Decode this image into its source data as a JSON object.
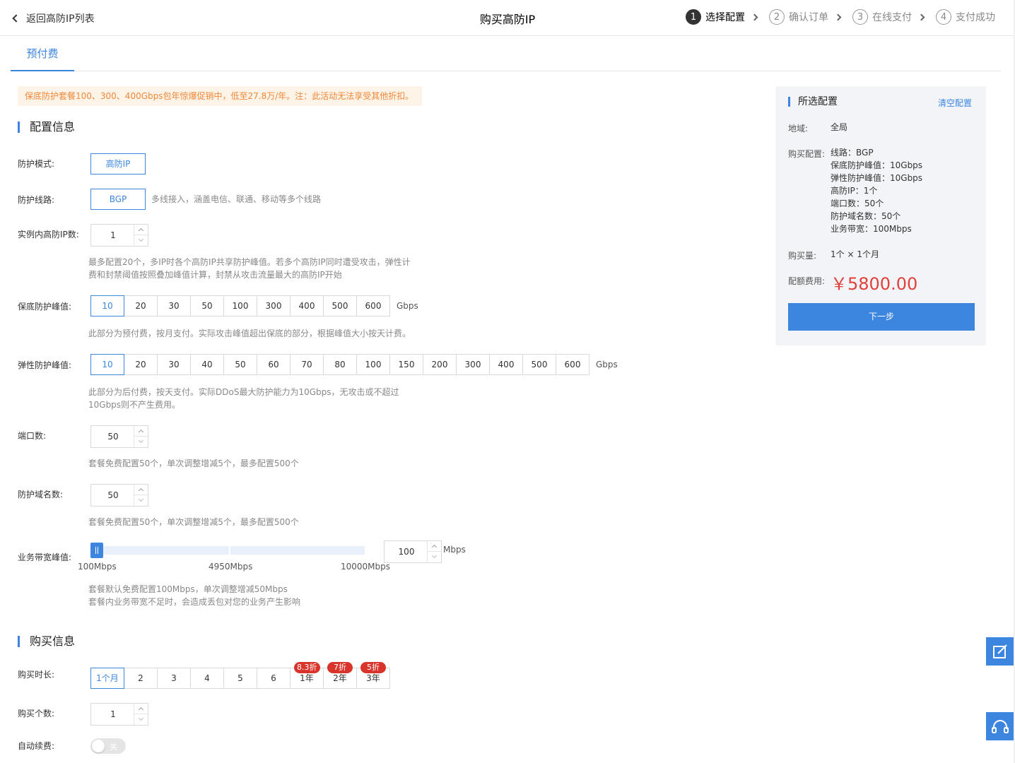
{
  "header": {
    "back_label": "返回高防IP列表",
    "title": "购买高防IP",
    "steps": [
      {
        "num": "1",
        "label": "选择配置"
      },
      {
        "num": "2",
        "label": "确认订单"
      },
      {
        "num": "3",
        "label": "在线支付"
      },
      {
        "num": "4",
        "label": "支付成功"
      }
    ]
  },
  "tab": {
    "label": "预付费"
  },
  "promo": "保底防护套餐100、300、400Gbps包年惊爆促销中，低至27.8万/年。注：此活动无法享受其他折扣。",
  "config": {
    "section_title": "配置信息",
    "mode": {
      "label": "防护模式:",
      "value": "高防IP"
    },
    "line": {
      "label": "防护线路:",
      "value": "BGP",
      "hint": "多线接入，涵盖电信、联通、移动等多个线路"
    },
    "ip_count": {
      "label": "实例内高防IP数:",
      "value": "1",
      "hint1": "最多配置20个，多IP时各个高防IP共享防护峰值。若多个高防IP同时遭受攻击，弹性计",
      "hint2": "费和封禁阈值按照叠加峰值计算，封禁从攻击流量最大的高防IP开始"
    },
    "base_peak": {
      "label": "保底防护峰值:",
      "options": [
        "10",
        "20",
        "30",
        "50",
        "100",
        "300",
        "400",
        "500",
        "600"
      ],
      "selected": "10",
      "unit": "Gbps",
      "hint": "此部分为预付费，按月支付。实际攻击峰值超出保底的部分，根据峰值大小按天计费。"
    },
    "elastic_peak": {
      "label": "弹性防护峰值:",
      "options": [
        "10",
        "20",
        "30",
        "40",
        "50",
        "60",
        "70",
        "80",
        "100",
        "150",
        "200",
        "300",
        "400",
        "500",
        "600"
      ],
      "selected": "10",
      "unit": "Gbps",
      "hint1": "此部分为后付费，按天支付。实际DDoS最大防护能力为10Gbps，无攻击或不超过",
      "hint2": "10Gbps则不产生费用。"
    },
    "ports": {
      "label": "端口数:",
      "value": "50",
      "hint": "套餐免费配置50个，单次调整增减5个，最多配置500个"
    },
    "domains": {
      "label": "防护域名数:",
      "value": "50",
      "hint": "套餐免费配置50个，单次调整增减5个，最多配置500个"
    },
    "bandwidth": {
      "label": "业务带宽峰值:",
      "value": "100",
      "unit": "Mbps",
      "min_label": "100Mbps",
      "mid_label": "4950Mbps",
      "max_label": "10000Mbps",
      "min": 100,
      "max": 10000,
      "current": 100,
      "hint1": "套餐默认免费配置100Mbps，单次调整增减50Mbps",
      "hint2": "套餐内业务带宽不足时，会造成丢包对您的业务产生影响"
    }
  },
  "purchase": {
    "section_title": "购买信息",
    "duration": {
      "label": "购买时长:",
      "options": [
        {
          "label": "1个月",
          "badge": ""
        },
        {
          "label": "2",
          "badge": ""
        },
        {
          "label": "3",
          "badge": ""
        },
        {
          "label": "4",
          "badge": ""
        },
        {
          "label": "5",
          "badge": ""
        },
        {
          "label": "6",
          "badge": ""
        },
        {
          "label": "1年",
          "badge": "8.3折"
        },
        {
          "label": "2年",
          "badge": "7折"
        },
        {
          "label": "3年",
          "badge": "5折"
        }
      ],
      "selected": "1个月"
    },
    "quantity": {
      "label": "购买个数:",
      "value": "1"
    },
    "auto_renew": {
      "label": "自动续费:",
      "state": "关"
    }
  },
  "summary": {
    "title": "所选配置",
    "clear": "清空配置",
    "region_label": "地域:",
    "region": "全局",
    "config_label": "购买配置:",
    "config_lines": [
      "线路：BGP",
      "保底防护峰值：10Gbps",
      "弹性防护峰值：10Gbps",
      "高防IP：1个",
      "端口数：50个",
      "防护域名数：50个",
      "业务带宽：100Mbps"
    ],
    "qty_label": "购买量:",
    "qty": "1个 × 1个月",
    "fee_label": "配额费用:",
    "price": "￥5800.00",
    "next": "下一步"
  },
  "colors": {
    "accent": "#3c86e0",
    "price": "#e0413b",
    "badge": "#d9342b",
    "promo_text": "#f0883a"
  },
  "float_icons": [
    "edit-icon",
    "headset-icon"
  ]
}
